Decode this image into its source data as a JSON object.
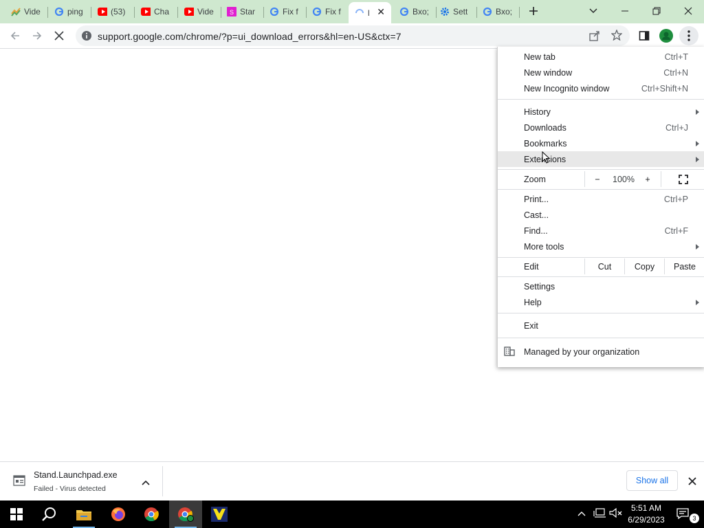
{
  "tabs": [
    {
      "title": "Vide",
      "icon": "tab-favicon-video"
    },
    {
      "title": "ping",
      "icon": "google-icon"
    },
    {
      "title": "(53)",
      "icon": "youtube-icon"
    },
    {
      "title": "Cha",
      "icon": "youtube-icon"
    },
    {
      "title": "Vide",
      "icon": "youtube-icon"
    },
    {
      "title": "Star",
      "icon": "site-favicon-pink"
    },
    {
      "title": "Fix f",
      "icon": "google-icon"
    },
    {
      "title": "Fix f",
      "icon": "google-icon"
    },
    {
      "title": "l",
      "icon": "loading-spinner-icon",
      "active": true
    },
    {
      "title": "Bxo;",
      "icon": "google-icon"
    },
    {
      "title": "Sett",
      "icon": "gear-icon"
    },
    {
      "title": "Bxo;",
      "icon": "google-icon"
    }
  ],
  "omnibox": {
    "url": "support.google.com/chrome/?p=ui_download_errors&hl=en-US&ctx=7"
  },
  "menu": {
    "new_tab": "New tab",
    "new_tab_sc": "Ctrl+T",
    "new_window": "New window",
    "new_window_sc": "Ctrl+N",
    "incognito": "New Incognito window",
    "incognito_sc": "Ctrl+Shift+N",
    "history": "History",
    "downloads": "Downloads",
    "downloads_sc": "Ctrl+J",
    "bookmarks": "Bookmarks",
    "extensions": "Extensions",
    "zoom": "Zoom",
    "zoom_minus": "−",
    "zoom_level": "100%",
    "zoom_plus": "+",
    "print": "Print...",
    "print_sc": "Ctrl+P",
    "cast": "Cast...",
    "find": "Find...",
    "find_sc": "Ctrl+F",
    "more_tools": "More tools",
    "edit": "Edit",
    "cut": "Cut",
    "copy": "Copy",
    "paste": "Paste",
    "settings": "Settings",
    "help": "Help",
    "exit": "Exit",
    "managed": "Managed by your organization"
  },
  "download": {
    "filename": "Stand.Launchpad.exe",
    "status": "Failed - Virus detected",
    "show_all": "Show all"
  },
  "taskbar": {
    "time": "5:51 AM",
    "date": "6/29/2023",
    "notification_count": "3"
  },
  "colors": {
    "tabstrip": "#cfe8cf",
    "link_blue": "#1a73e8",
    "youtube_red": "#ff0000"
  }
}
